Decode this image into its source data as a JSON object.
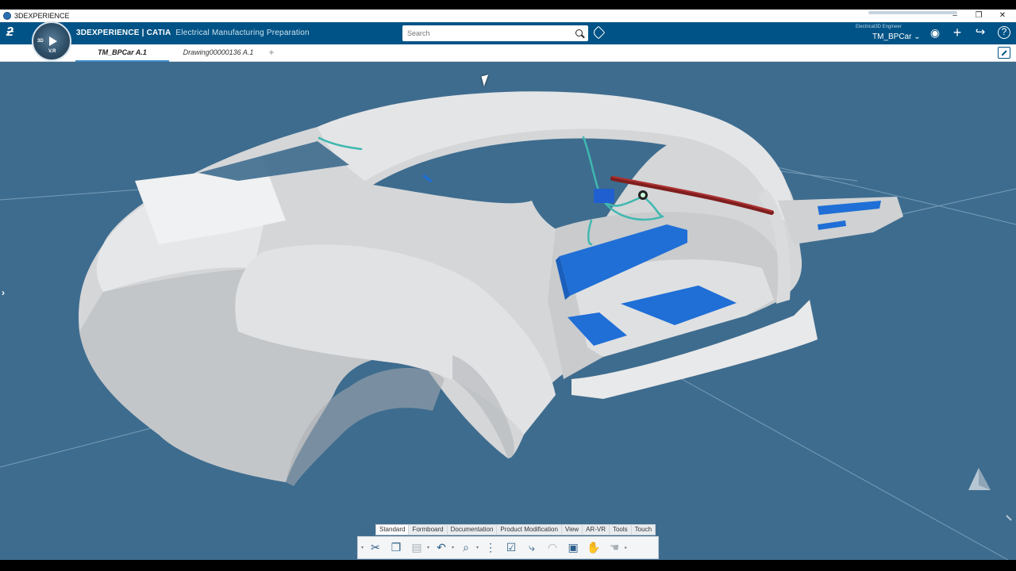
{
  "window": {
    "title": "3DEXPERIENCE",
    "controls": [
      "–",
      "❐",
      "✕"
    ]
  },
  "header": {
    "brand_prefix": "3DEXPERIENCE | CATIA",
    "app_name": "Electrical Manufacturing Preparation",
    "search_placeholder": "Search",
    "role": "Electrical3D Engineer",
    "user": "TM_BPCar ⌄",
    "compass_labels": [
      "3D",
      "V.R"
    ],
    "icons": [
      "tag-icon",
      "user-icon",
      "add-icon",
      "share-icon",
      "help-icon"
    ]
  },
  "tabs": [
    {
      "label": "TM_BPCar A.1",
      "active": true
    },
    {
      "label": "Drawing00000136 A.1",
      "active": false
    }
  ],
  "tab_add": "+",
  "action_tabs": [
    "Standard",
    "Formboard",
    "Documentation",
    "Product Modification",
    "View",
    "AR-VR",
    "Tools",
    "Touch"
  ],
  "active_action_tab": "Standard",
  "tools": [
    {
      "name": "cut-icon",
      "glyph": "✂",
      "enabled": true
    },
    {
      "name": "copy-icon",
      "glyph": "❐",
      "enabled": true
    },
    {
      "name": "paste-icon",
      "glyph": "📋",
      "enabled": false
    },
    {
      "name": "undo-icon",
      "glyph": "↶",
      "enabled": true
    },
    {
      "name": "zoom-icon",
      "glyph": "🔍",
      "enabled": true
    },
    {
      "name": "tree-icon",
      "glyph": "⋮",
      "enabled": true
    },
    {
      "name": "check-icon",
      "glyph": "☑",
      "enabled": true
    },
    {
      "name": "branch-icon",
      "glyph": "⤷",
      "enabled": true
    },
    {
      "name": "measure-icon",
      "glyph": "◠",
      "enabled": false
    },
    {
      "name": "screen-icon",
      "glyph": "▣",
      "enabled": true
    },
    {
      "name": "pointer-icon",
      "glyph": "✋",
      "enabled": false
    },
    {
      "name": "hand-icon",
      "glyph": "☚",
      "enabled": false
    }
  ],
  "colors": {
    "header_blue": "#005386",
    "viewport_bg": "#3e6c8e",
    "body_gray": "#d9dbdd",
    "floor_blue": "#1f6fd6",
    "harness_red": "#8a2222",
    "wire_teal": "#3fb8b0"
  }
}
